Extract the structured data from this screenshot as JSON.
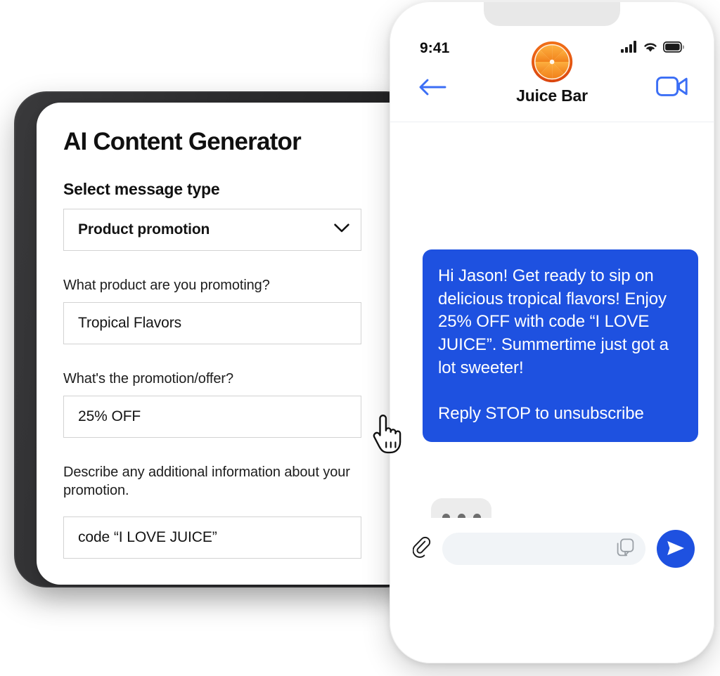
{
  "generator": {
    "title": "AI Content Generator",
    "message_type_label": "Select message type",
    "message_type_value": "Product promotion",
    "message_type_options": [
      "Product promotion"
    ],
    "product_label": "What product are you promoting?",
    "product_value": "Tropical Flavors",
    "offer_label": "What's the promotion/offer?",
    "offer_value": "25% OFF",
    "additional_label": "Describe any additional information about your promotion.",
    "additional_value": "code “I LOVE JUICE”",
    "chevron_icon": "chevron-down-icon",
    "cursor_icon": "pointing-hand-cursor"
  },
  "phone": {
    "status": {
      "time": "9:41",
      "signal_icon": "cellular-signal-icon",
      "wifi_icon": "wifi-icon",
      "battery_icon": "battery-full-icon"
    },
    "header": {
      "contact_name": "Juice Bar",
      "logo_icon": "orange-slice-logo",
      "back_icon": "arrow-left-icon",
      "video_icon": "video-camera-icon"
    },
    "conversation": {
      "outgoing_message": "Hi Jason! Get ready to sip on delicious tropical flavors! Enjoy 25% OFF with code “I LOVE JUICE”. Summertime just got a lot sweeter!\n\nReply STOP to unsubscribe",
      "typing_indicator": "typing-indicator"
    },
    "composer": {
      "attach_icon": "paperclip-icon",
      "sticker_icon": "sticker-icon",
      "send_icon": "send-icon",
      "input_value": "",
      "input_placeholder": ""
    }
  },
  "colors": {
    "brand_blue": "#1E51E0",
    "header_blue": "#3B6EF5",
    "orange": "#F08A1E",
    "orange_dark": "#D9430F",
    "field_border": "#D2D2D2",
    "scrollbar": "#E2E2E2",
    "typing_bubble": "#ECECEC"
  }
}
